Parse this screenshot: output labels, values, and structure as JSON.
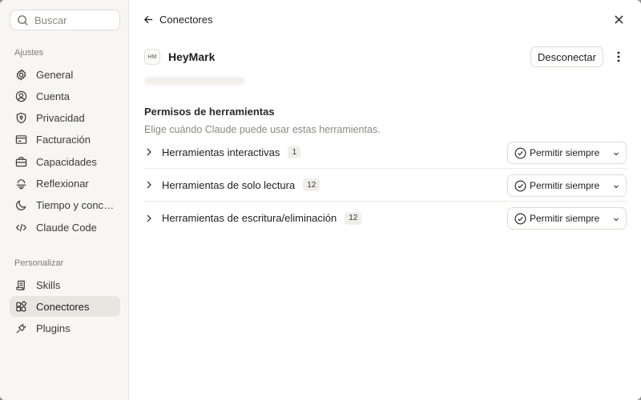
{
  "sidebar": {
    "search_placeholder": "Buscar",
    "sections": [
      {
        "label": "Ajustes",
        "items": [
          {
            "label": "General",
            "icon": "gear-icon"
          },
          {
            "label": "Cuenta",
            "icon": "user-icon"
          },
          {
            "label": "Privacidad",
            "icon": "shield-icon"
          },
          {
            "label": "Facturación",
            "icon": "credit-card-icon"
          },
          {
            "label": "Capacidades",
            "icon": "briefcase-icon"
          },
          {
            "label": "Reflexionar",
            "icon": "reflect-icon"
          },
          {
            "label": "Tiempo y conce…",
            "icon": "moon-icon"
          },
          {
            "label": "Claude Code",
            "icon": "code-icon"
          }
        ]
      },
      {
        "label": "Personalizar",
        "items": [
          {
            "label": "Skills",
            "icon": "scroll-icon"
          },
          {
            "label": "Conectores",
            "icon": "connectors-icon",
            "active": true
          },
          {
            "label": "Plugins",
            "icon": "plug-icon"
          }
        ]
      }
    ]
  },
  "header": {
    "back_label": "Conectores"
  },
  "connector": {
    "logo_text": "HM",
    "name": "HeyMark",
    "disconnect_label": "Desconectar"
  },
  "permissions": {
    "title": "Permisos de herramientas",
    "subtitle": "Elige cuándo Claude puede usar estas herramientas.",
    "rows": [
      {
        "label": "Herramientas interactivas",
        "count": "1",
        "setting": "Permitir siempre"
      },
      {
        "label": "Herramientas de solo lectura",
        "count": "12",
        "setting": "Permitir siempre"
      },
      {
        "label": "Herramientas de escritura/eliminación",
        "count": "12",
        "setting": "Permitir siempre"
      }
    ]
  },
  "colors": {
    "sidebar_bg": "#f7f6f3",
    "active_item_bg": "#e8e6e1",
    "text": "#1f1e1d",
    "muted_text": "#8a8884"
  }
}
